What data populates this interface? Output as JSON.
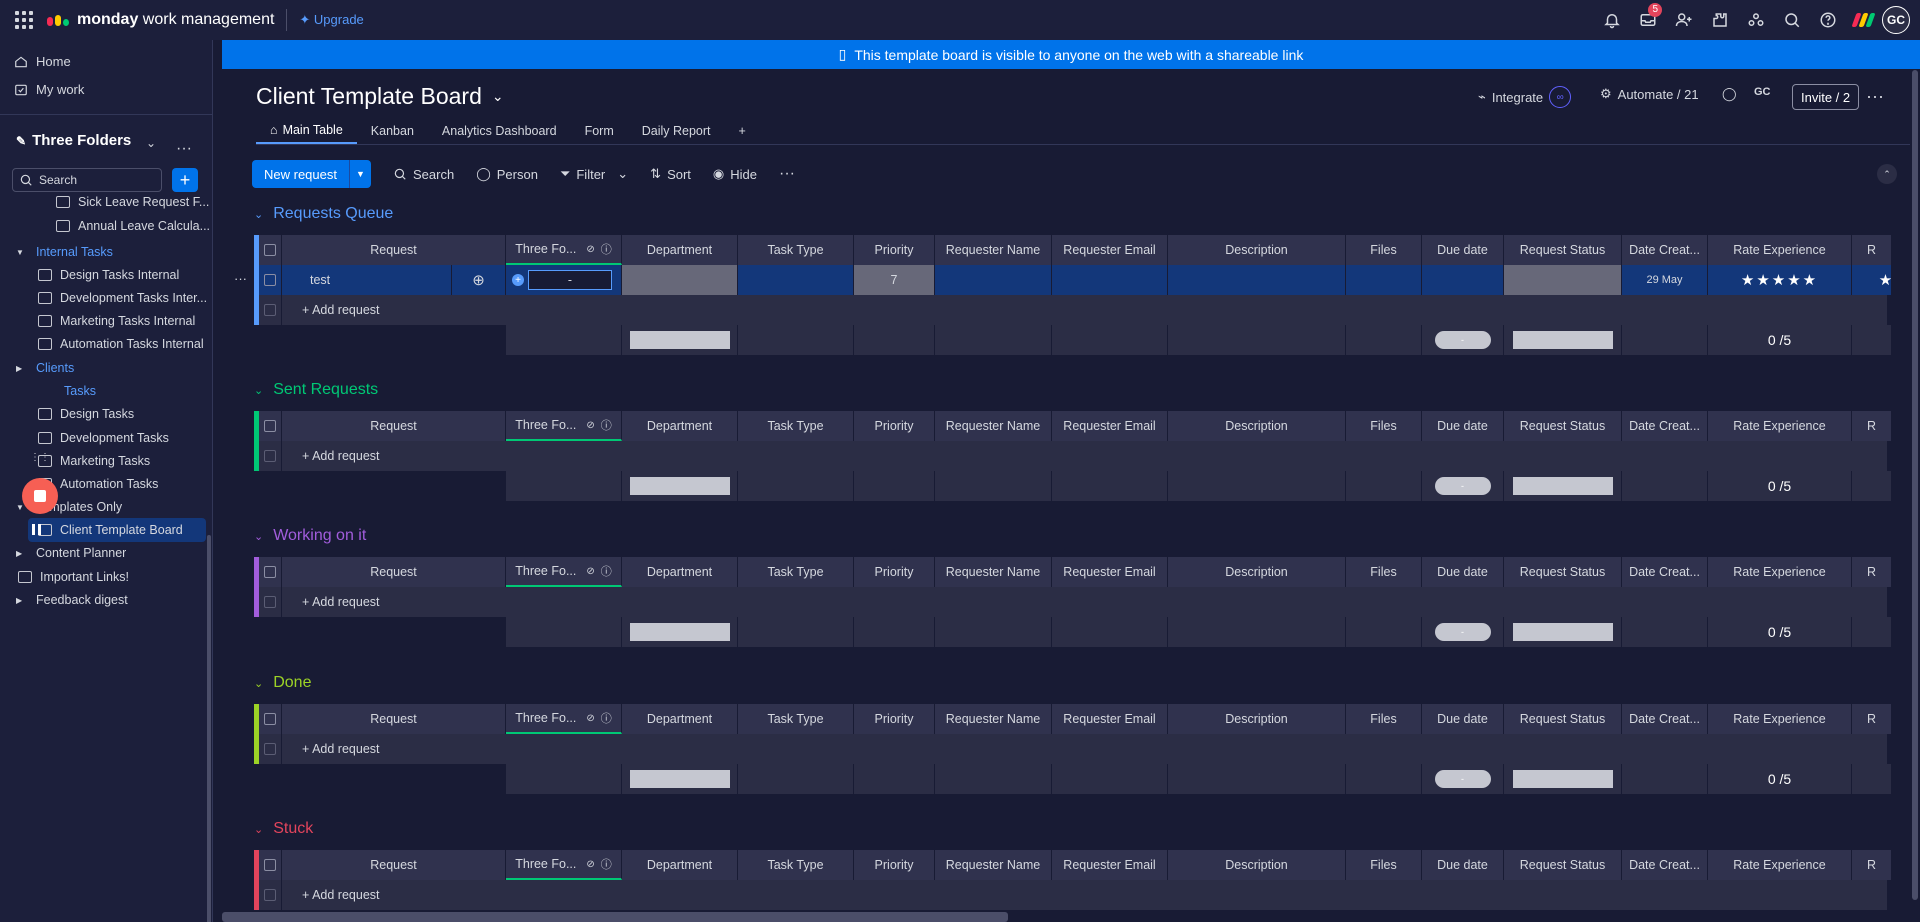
{
  "topbar": {
    "brand_bold": "monday",
    "brand_rest": " work management",
    "upgrade": "Upgrade",
    "inbox_count": "5",
    "avatar": "GC"
  },
  "sidebar": {
    "home": "Home",
    "my_work": "My work",
    "workspace": "Three Folders",
    "search_placeholder": "Search",
    "tree": [
      {
        "label": "Sick Leave Request F...",
        "type": "board",
        "indent": 2
      },
      {
        "label": "Annual Leave Calcula...",
        "type": "board",
        "indent": 2
      },
      {
        "label": "Internal Tasks",
        "type": "folder-open",
        "indent": 0
      },
      {
        "label": "Design Tasks Internal",
        "type": "board",
        "indent": 1
      },
      {
        "label": "Development Tasks Inter...",
        "type": "board",
        "indent": 1
      },
      {
        "label": "Marketing Tasks Internal",
        "type": "board",
        "indent": 1
      },
      {
        "label": "Automation Tasks Internal",
        "type": "board",
        "indent": 1
      },
      {
        "label": "Clients",
        "type": "folder-closed",
        "indent": 0
      },
      {
        "label": "Tasks",
        "type": "board-partial",
        "indent": 1
      },
      {
        "label": "Design Tasks",
        "type": "board",
        "indent": 1
      },
      {
        "label": "Development Tasks",
        "type": "board",
        "indent": 1
      },
      {
        "label": "Marketing Tasks",
        "type": "board",
        "indent": 1
      },
      {
        "label": "Automation Tasks",
        "type": "board",
        "indent": 1
      },
      {
        "label": "Templates Only",
        "type": "folder-open-white",
        "indent": 0
      },
      {
        "label": "Client Template Board",
        "type": "board-active",
        "indent": 1
      },
      {
        "label": "Content Planner",
        "type": "folder-closed-white",
        "indent": 0
      },
      {
        "label": "Important Links!",
        "type": "board-root",
        "indent": 0
      },
      {
        "label": "Feedback digest",
        "type": "folder-closed-white",
        "indent": 0
      }
    ]
  },
  "banner": "This template board is visible to anyone on the web with a shareable link",
  "board": {
    "title": "Client Template Board",
    "integrate": "Integrate",
    "automate": "Automate / 21",
    "gc": "GC",
    "invite": "Invite / 2",
    "tabs": [
      "Main Table",
      "Kanban",
      "Analytics Dashboard",
      "Form",
      "Daily Report"
    ],
    "toolbar": {
      "new": "New request",
      "search": "Search",
      "person": "Person",
      "filter": "Filter",
      "sort": "Sort",
      "hide": "Hide"
    }
  },
  "columns": [
    "Request",
    "Three Fo...",
    "Department",
    "Task Type",
    "Priority",
    "Requester Name",
    "Requester Email",
    "Description",
    "Files",
    "Due date",
    "Request Status",
    "Date Creat...",
    "Rate Experience",
    "R"
  ],
  "add_row": "+ Add request",
  "rating_summary": "0 /5",
  "groups": [
    {
      "name": "Requests Queue",
      "color": "#579bfc",
      "rows": [
        {
          "request": "test",
          "three": "-",
          "priority": "7",
          "date": "29 May",
          "stars": "★★★★★"
        }
      ]
    },
    {
      "name": "Sent Requests",
      "color": "#00c875",
      "rows": []
    },
    {
      "name": "Working on it",
      "color": "#a25ddc",
      "rows": []
    },
    {
      "name": "Done",
      "color": "#9cd326",
      "rows": []
    },
    {
      "name": "Stuck",
      "color": "#e2445c",
      "rows": []
    }
  ]
}
